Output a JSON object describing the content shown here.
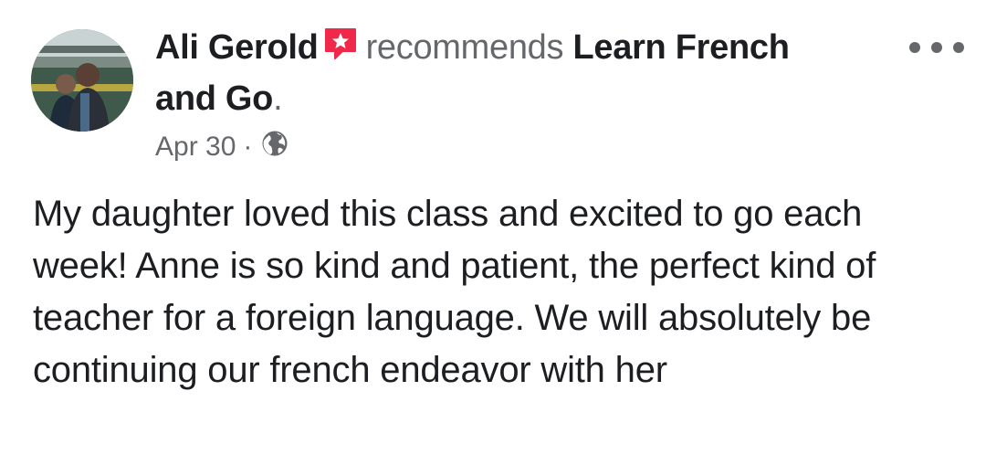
{
  "post": {
    "author": "Ali Gerold",
    "verb": "recommends",
    "page_name": "Learn French and Go",
    "period": ".",
    "date": "Apr 30",
    "separator": "·",
    "visibility_icon": "globe-icon",
    "recommend_icon": "recommend-star-icon",
    "more_icon": "more-options-icon",
    "text": "My daughter loved this class and excited to go each week! Anne is so kind and patient, the perfect kind of teacher for a foreign language. We will absolutely be continuing our french endeavor with her"
  },
  "colors": {
    "primary_text": "#1c1e21",
    "secondary_text": "#65676b",
    "recommend_red": "#f02849"
  }
}
